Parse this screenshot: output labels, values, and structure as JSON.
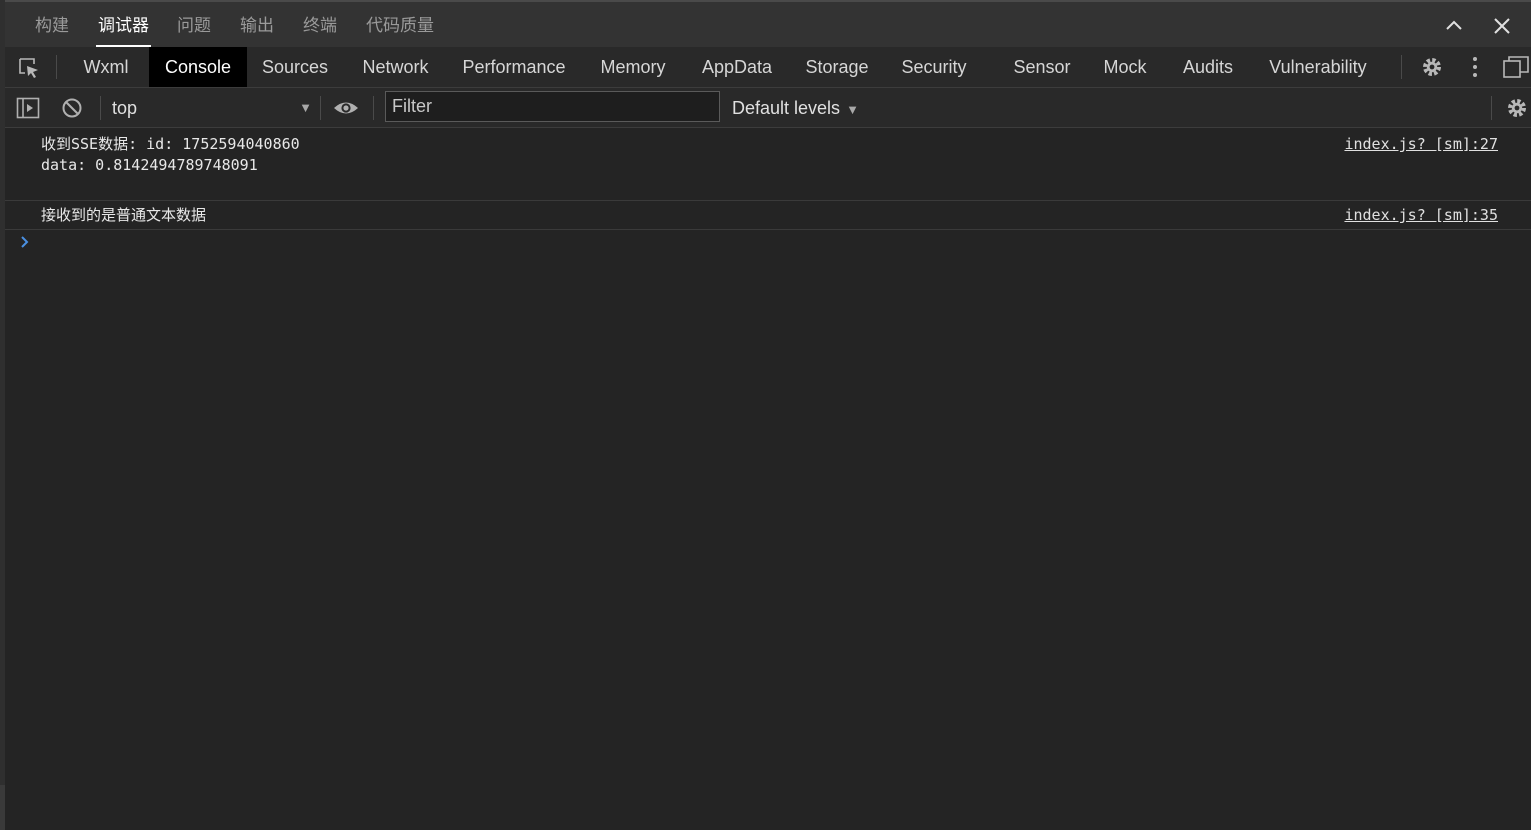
{
  "panel_tabs": [
    {
      "label": "构建",
      "active": false
    },
    {
      "label": "调试器",
      "active": true
    },
    {
      "label": "问题",
      "active": false
    },
    {
      "label": "输出",
      "active": false
    },
    {
      "label": "终端",
      "active": false
    },
    {
      "label": "代码质量",
      "active": false
    }
  ],
  "devtools_tabs": [
    {
      "label": "Wxml",
      "active": false
    },
    {
      "label": "Console",
      "active": true
    },
    {
      "label": "Sources",
      "active": false
    },
    {
      "label": "Network",
      "active": false
    },
    {
      "label": "Performance",
      "active": false
    },
    {
      "label": "Memory",
      "active": false
    },
    {
      "label": "AppData",
      "active": false
    },
    {
      "label": "Storage",
      "active": false
    },
    {
      "label": "Security",
      "active": false
    },
    {
      "label": "Sensor",
      "active": false
    },
    {
      "label": "Mock",
      "active": false
    },
    {
      "label": "Audits",
      "active": false
    },
    {
      "label": "Vulnerability",
      "active": false
    }
  ],
  "toolbar": {
    "context": "top",
    "filter_placeholder": "Filter",
    "filter_value": "",
    "levels": "Default levels"
  },
  "messages": [
    {
      "text": "收到SSE数据: id: 1752594040860\ndata: 0.8142494789748091",
      "source": "index.js? [sm]:27"
    },
    {
      "text": "接收到的是普通文本数据",
      "source": "index.js? [sm]:35"
    }
  ],
  "colors": {
    "background": "#242424",
    "toolbar": "#292929",
    "panel_bar": "#333333",
    "active_tab": "#000000",
    "prompt_caret": "#4a90e2"
  },
  "icons": [
    "inspect-element-icon",
    "chevron-up-icon",
    "close-icon",
    "gear-icon",
    "more-vertical-icon",
    "undock-icon",
    "sidebar-toggle-icon",
    "clear-console-icon",
    "eye-icon",
    "chevron-right-icon"
  ]
}
